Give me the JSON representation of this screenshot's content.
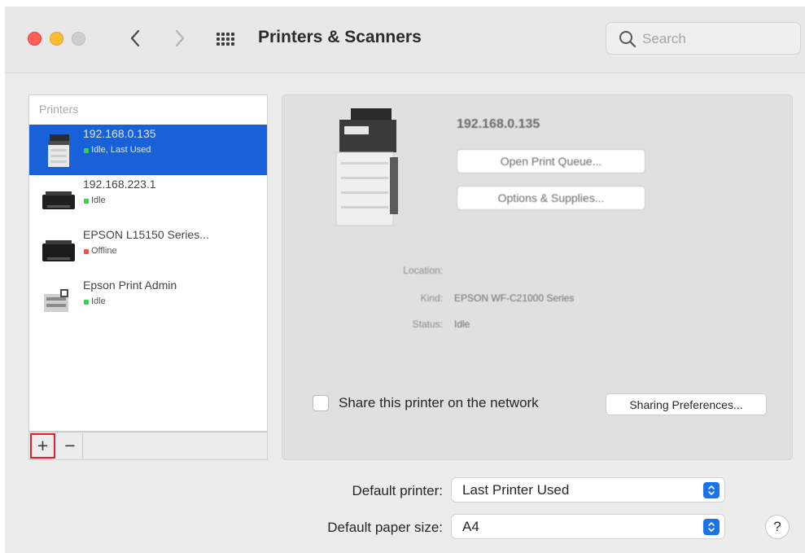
{
  "toolbar": {
    "title": "Printers & Scanners",
    "search_placeholder": "Search"
  },
  "printers": {
    "header": "Printers",
    "items": [
      {
        "name": "192.168.0.135",
        "status": "Idle, Last Used",
        "status_color": "#3ccf4e",
        "selected": true,
        "icon": "multifunction-printer-icon"
      },
      {
        "name": "192.168.223.1",
        "status": "Idle",
        "status_color": "#3ccf4e",
        "selected": false,
        "icon": "inkjet-printer-icon"
      },
      {
        "name": "EPSON L15150 Series...",
        "status": "Offline",
        "status_color": "#ff4b4b",
        "selected": false,
        "icon": "inkjet-printer-icon"
      },
      {
        "name": "Epson Print Admin",
        "status": "Idle",
        "status_color": "#3ccf4e",
        "selected": false,
        "icon": "print-server-icon"
      }
    ],
    "add_label": "+",
    "remove_label": "−"
  },
  "detail": {
    "name": "192.168.0.135",
    "open_queue_label": "Open Print Queue...",
    "options_label": "Options & Supplies...",
    "location_label": "Location:",
    "location_value": "",
    "kind_label": "Kind:",
    "kind_value": "EPSON WF-C21000 Series",
    "status_label": "Status:",
    "status_value": "Idle",
    "share_label": "Share this printer on the network",
    "share_checked": false,
    "sharing_prefs_label": "Sharing Preferences..."
  },
  "defaults": {
    "printer_label": "Default printer:",
    "printer_value": "Last Printer Used",
    "paper_label": "Default paper size:",
    "paper_value": "A4"
  },
  "help_label": "?",
  "colors": {
    "accent": "#1961d9",
    "close": "#fe5f57",
    "minimize": "#febc2e",
    "highlight_box": "#e0202a"
  }
}
